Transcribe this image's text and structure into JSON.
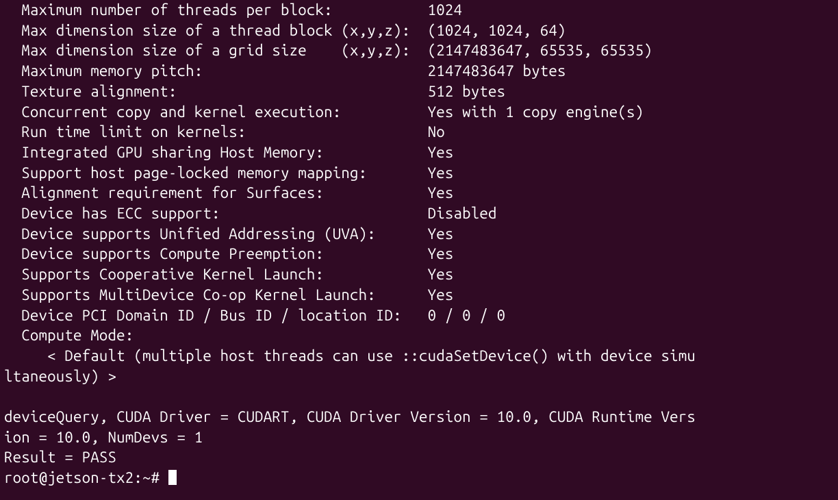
{
  "device_query_output": {
    "properties": [
      {
        "label": "Maximum number of threads per block:",
        "value": "1024",
        "label_pad": 47
      },
      {
        "label": "Max dimension size of a thread block (x,y,z):",
        "value": "(1024, 1024, 64)",
        "label_pad": 47
      },
      {
        "label": "Max dimension size of a grid size    (x,y,z):",
        "value": "(2147483647, 65535, 65535)",
        "label_pad": 47
      },
      {
        "label": "Maximum memory pitch:",
        "value": "2147483647 bytes",
        "label_pad": 47
      },
      {
        "label": "Texture alignment:",
        "value": "512 bytes",
        "label_pad": 47
      },
      {
        "label": "Concurrent copy and kernel execution:",
        "value": "Yes with 1 copy engine(s)",
        "label_pad": 47
      },
      {
        "label": "Run time limit on kernels:",
        "value": "No",
        "label_pad": 47
      },
      {
        "label": "Integrated GPU sharing Host Memory:",
        "value": "Yes",
        "label_pad": 47
      },
      {
        "label": "Support host page-locked memory mapping:",
        "value": "Yes",
        "label_pad": 47
      },
      {
        "label": "Alignment requirement for Surfaces:",
        "value": "Yes",
        "label_pad": 47
      },
      {
        "label": "Device has ECC support:",
        "value": "Disabled",
        "label_pad": 47
      },
      {
        "label": "Device supports Unified Addressing (UVA):",
        "value": "Yes",
        "label_pad": 47
      },
      {
        "label": "Device supports Compute Preemption:",
        "value": "Yes",
        "label_pad": 47
      },
      {
        "label": "Supports Cooperative Kernel Launch:",
        "value": "Yes",
        "label_pad": 47
      },
      {
        "label": "Supports MultiDevice Co-op Kernel Launch:",
        "value": "Yes",
        "label_pad": 47
      },
      {
        "label": "Device PCI Domain ID / Bus ID / location ID:",
        "value": "0 / 0 / 0",
        "label_pad": 47
      },
      {
        "label": "Compute Mode:",
        "value": "",
        "label_pad": 47
      }
    ],
    "compute_mode_detail": "     < Default (multiple host threads can use ::cudaSetDevice() with device simultaneously) >",
    "summary_line": "deviceQuery, CUDA Driver = CUDART, CUDA Driver Version = 10.0, CUDA Runtime Version = 10.0, NumDevs = 1",
    "result_line": "Result = PASS"
  },
  "prompt": {
    "user_host": "root@jetson-tx2",
    "cwd": "~",
    "symbol": "#"
  },
  "colors": {
    "background": "#300a24",
    "text": "#ffffff"
  }
}
